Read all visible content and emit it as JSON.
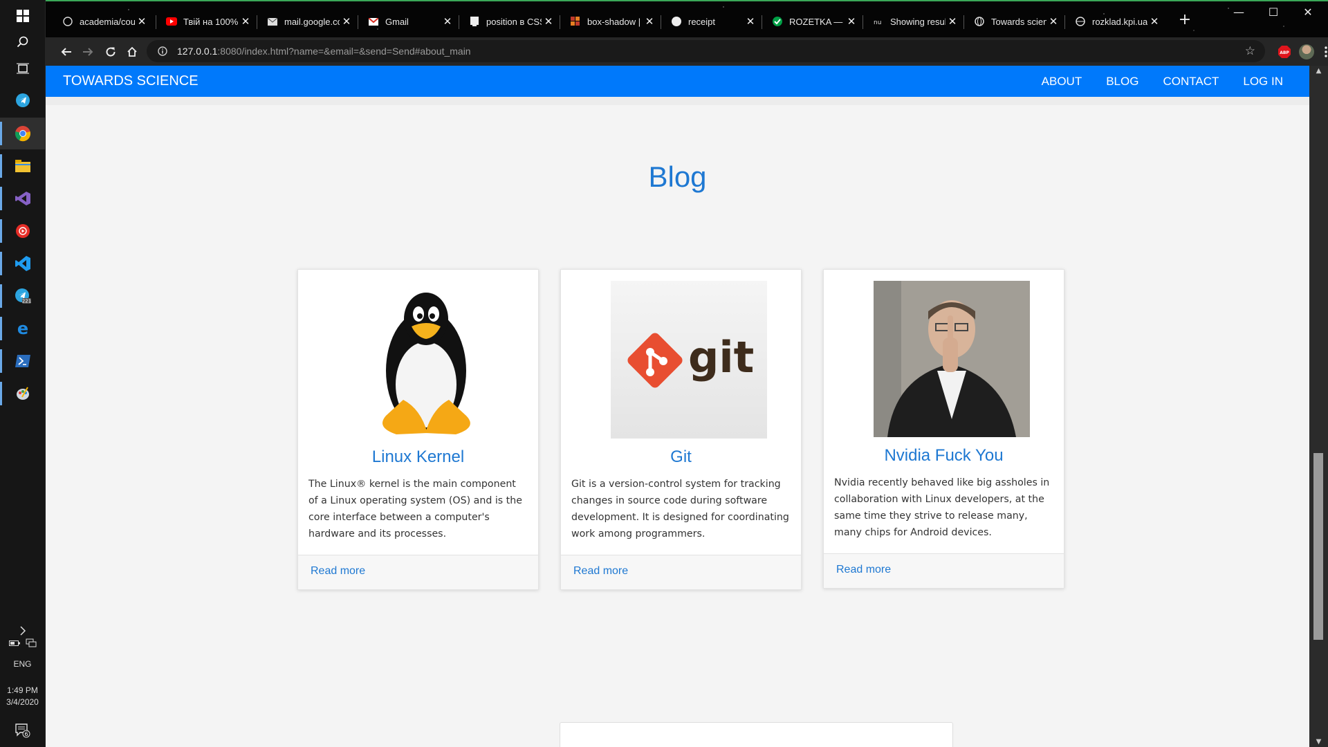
{
  "taskbar": {
    "language": "ENG",
    "time": "1:49 PM",
    "date": "3/4/2020",
    "notification_count": "6",
    "telegram_badge": "221"
  },
  "browser": {
    "tabs": [
      {
        "title": "academia/cour",
        "icon": "github-icon"
      },
      {
        "title": "Твій на 100%",
        "icon": "youtube-icon"
      },
      {
        "title": "mail.google.co",
        "icon": "mail-icon"
      },
      {
        "title": "Gmail",
        "icon": "gmail-icon"
      },
      {
        "title": "position в CSS",
        "icon": "page-icon"
      },
      {
        "title": "box-shadow | h",
        "icon": "page-icon"
      },
      {
        "title": "receipt",
        "icon": "page-icon"
      },
      {
        "title": "ROZETKA — M",
        "icon": "rozetka-icon"
      },
      {
        "title": "Showing result",
        "icon": "page-icon"
      },
      {
        "title": "Towards scienc",
        "icon": "globe-icon"
      },
      {
        "title": "rozklad.kpi.ua/",
        "icon": "globe-icon"
      }
    ],
    "url_host": "127.0.0.1",
    "url_rest": ":8080/index.html?name=&email=&send=Send#about_main",
    "extension_label": "ABP"
  },
  "site": {
    "brand": "TOWARDS SCIENCE",
    "nav": [
      "ABOUT",
      "BLOG",
      "CONTACT",
      "LOG IN"
    ],
    "blog_title": "Blog",
    "posts": [
      {
        "title": "Linux Kernel",
        "text": "The Linux® kernel is the main component of a Linux operating system (OS) and is the core interface between a computer's hardware and its processes.",
        "link": "Read more",
        "image": "tux-penguin"
      },
      {
        "title": "Git",
        "text": "Git is a version-control system for tracking changes in source code during software development. It is designed for coordinating work among programmers.",
        "link": "Read more",
        "image": "git-logo"
      },
      {
        "title": "Nvidia Fuck You",
        "text": "Nvidia recently behaved like big assholes in collaboration with Linux developers, at the same time they strive to release many, many chips for Android devices.",
        "link": "Read more",
        "image": "person-photo"
      }
    ]
  },
  "colors": {
    "navbar": "#0079fb",
    "accent_text": "#1e78d2",
    "page_bg": "#f4f4f4"
  }
}
